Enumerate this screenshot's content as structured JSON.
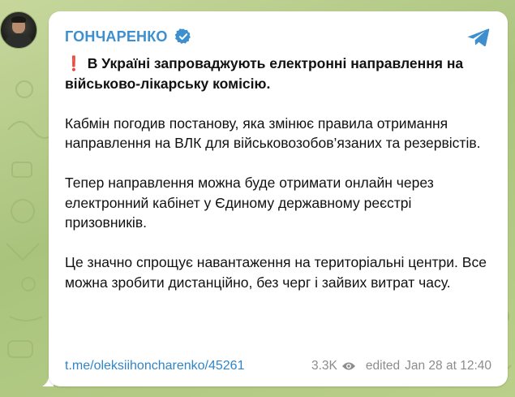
{
  "post": {
    "channel_name": "ГОНЧАРЕНКО",
    "headline_emoji": "❗",
    "headline": "В Україні запроваджують електронні направлення на військово-лікарську комісію.",
    "paragraphs": [
      "Кабмін погодив постанову, яка змінює правила отримання направлення на ВЛК для військовозобов’язаних та резервістів.",
      "Тепер направлення можна буде отримати онлайн через електронний кабінет у Єдиному державному реєстрі призовників.",
      "Це значно спрощує навантаження на територіальні центри. Все можна зробити дистанційно, без черг і зайвих витрат часу."
    ],
    "link": "t.me/oleksiihoncharenko/45261",
    "views": "3.3K",
    "edited_label": "edited",
    "timestamp": "Jan 28 at 12:40"
  },
  "icons": {
    "verified": "verified-badge-icon",
    "share": "telegram-share-icon",
    "views": "eye-icon"
  },
  "colors": {
    "channel_name": "#3d8fcd",
    "link": "#2f85c7",
    "verified_badge": "#3d8fcd",
    "meta_text": "#8c8c8c",
    "background": "#b7cc8c",
    "exclamation": "#e2231a"
  }
}
